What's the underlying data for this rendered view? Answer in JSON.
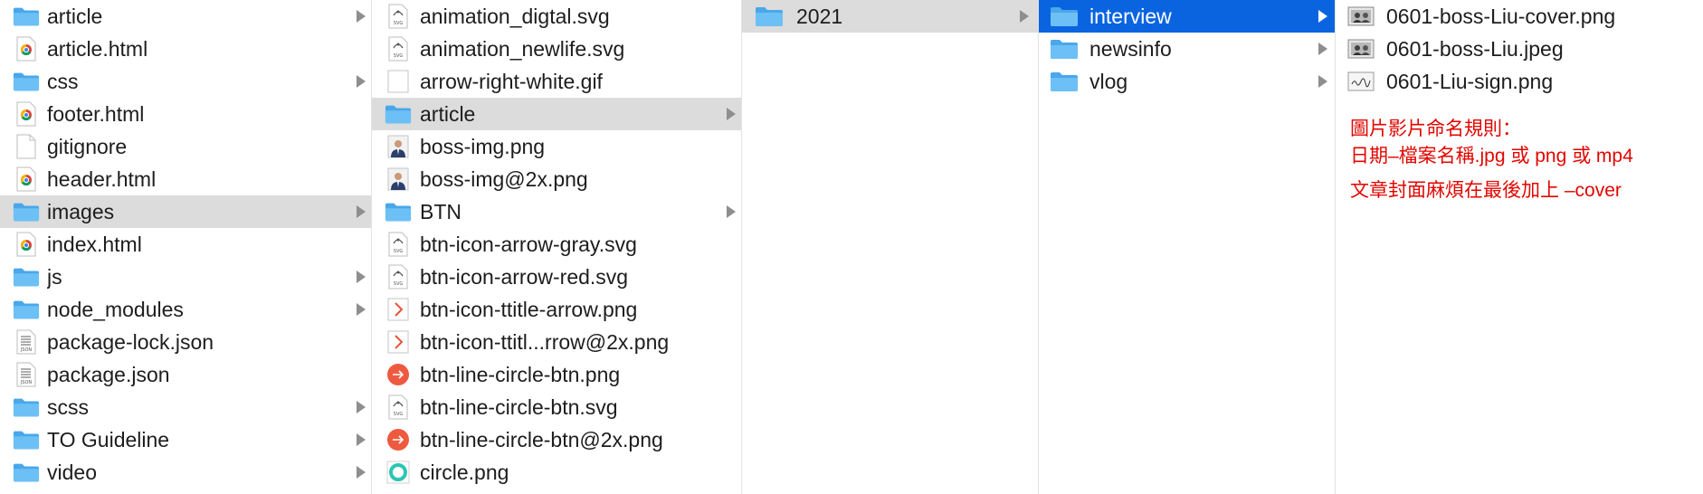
{
  "colors": {
    "folder": "#5ab3f0",
    "selection_gray": "#dcdcdc",
    "selection_blue": "#0a64e0",
    "note_red": "#e10600"
  },
  "columns": {
    "col1": [
      {
        "name": "article",
        "kind": "folder",
        "arrow": true
      },
      {
        "name": "article.html",
        "kind": "chrome-html"
      },
      {
        "name": "css",
        "kind": "folder",
        "arrow": true
      },
      {
        "name": "footer.html",
        "kind": "chrome-html"
      },
      {
        "name": "gitignore",
        "kind": "blank"
      },
      {
        "name": "header.html",
        "kind": "chrome-html"
      },
      {
        "name": "images",
        "kind": "folder",
        "arrow": true,
        "selected": "gray"
      },
      {
        "name": "index.html",
        "kind": "chrome-html"
      },
      {
        "name": "js",
        "kind": "folder",
        "arrow": true
      },
      {
        "name": "node_modules",
        "kind": "folder",
        "arrow": true
      },
      {
        "name": "package-lock.json",
        "kind": "json"
      },
      {
        "name": "package.json",
        "kind": "json"
      },
      {
        "name": "scss",
        "kind": "folder",
        "arrow": true
      },
      {
        "name": "TO Guideline",
        "kind": "folder",
        "arrow": true
      },
      {
        "name": "video",
        "kind": "folder",
        "arrow": true
      }
    ],
    "col2": [
      {
        "name": "animation_digtal.svg",
        "kind": "svg"
      },
      {
        "name": "animation_newlife.svg",
        "kind": "svg"
      },
      {
        "name": "arrow-right-white.gif",
        "kind": "blank-box"
      },
      {
        "name": "article",
        "kind": "folder",
        "arrow": true,
        "selected": "gray"
      },
      {
        "name": "boss-img.png",
        "kind": "portrait"
      },
      {
        "name": "boss-img@2x.png",
        "kind": "portrait"
      },
      {
        "name": "BTN",
        "kind": "folder",
        "arrow": true
      },
      {
        "name": "btn-icon-arrow-gray.svg",
        "kind": "svg"
      },
      {
        "name": "btn-icon-arrow-red.svg",
        "kind": "svg"
      },
      {
        "name": "btn-icon-ttitle-arrow.png",
        "kind": "red-chevron"
      },
      {
        "name": "btn-icon-ttitl...rrow@2x.png",
        "kind": "red-chevron"
      },
      {
        "name": "btn-line-circle-btn.png",
        "kind": "orange-circle"
      },
      {
        "name": "btn-line-circle-btn.svg",
        "kind": "svg"
      },
      {
        "name": "btn-line-circle-btn@2x.png",
        "kind": "orange-circle"
      },
      {
        "name": "circle.png",
        "kind": "teal-ring"
      }
    ],
    "col3": [
      {
        "name": "2021",
        "kind": "folder",
        "arrow": true,
        "selected": "gray"
      }
    ],
    "col4": [
      {
        "name": "interview",
        "kind": "folder",
        "arrow": true,
        "selected": "blue"
      },
      {
        "name": "newsinfo",
        "kind": "folder",
        "arrow": true
      },
      {
        "name": "vlog",
        "kind": "folder",
        "arrow": true
      }
    ],
    "col5": [
      {
        "name": "0601-boss-Liu-cover.png",
        "kind": "photo-thumb"
      },
      {
        "name": "0601-boss-Liu.jpeg",
        "kind": "photo-thumb"
      },
      {
        "name": "0601-Liu-sign.png",
        "kind": "sign-thumb"
      }
    ]
  },
  "notes": {
    "line1": "圖片影片命名規則：",
    "line2": "日期–檔案名稱.jpg 或 png 或 mp4",
    "line3": "文章封面麻煩在最後加上 –cover"
  },
  "icon_names": {
    "folder": "folder-icon",
    "chrome-html": "chrome-html-file-icon",
    "blank": "blank-file-icon",
    "json": "json-file-icon",
    "svg": "svg-file-icon",
    "blank-box": "gif-file-icon",
    "portrait": "portrait-image-icon",
    "red-chevron": "red-chevron-image-icon",
    "orange-circle": "orange-circle-arrow-icon",
    "teal-ring": "teal-ring-image-icon",
    "photo-thumb": "photo-thumbnail-icon",
    "sign-thumb": "signature-thumbnail-icon"
  }
}
